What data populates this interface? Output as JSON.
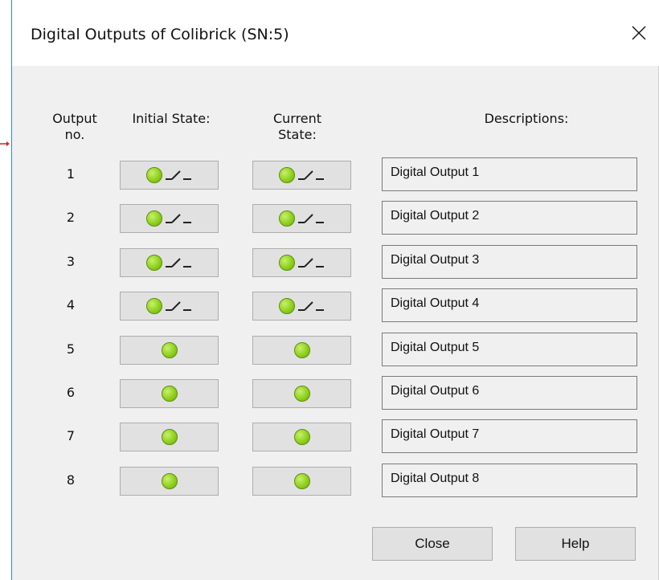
{
  "window": {
    "title": "Digital Outputs of Colibrick (SN:5)",
    "close_icon": "close-icon"
  },
  "headers": {
    "output_no_line1": "Output",
    "output_no_line2": "no.",
    "initial_state": "Initial State:",
    "current_state_line1": "Current",
    "current_state_line2": "State:",
    "descriptions": "Descriptions:"
  },
  "outputs": [
    {
      "number": "1",
      "initial_led": "on",
      "initial_switch": true,
      "current_led": "on",
      "current_switch": true,
      "description": "Digital Output 1"
    },
    {
      "number": "2",
      "initial_led": "on",
      "initial_switch": true,
      "current_led": "on",
      "current_switch": true,
      "description": "Digital Output 2"
    },
    {
      "number": "3",
      "initial_led": "on",
      "initial_switch": true,
      "current_led": "on",
      "current_switch": true,
      "description": "Digital Output 3"
    },
    {
      "number": "4",
      "initial_led": "on",
      "initial_switch": true,
      "current_led": "on",
      "current_switch": true,
      "description": "Digital Output 4"
    },
    {
      "number": "5",
      "initial_led": "on",
      "initial_switch": false,
      "current_led": "on",
      "current_switch": false,
      "description": "Digital Output 5"
    },
    {
      "number": "6",
      "initial_led": "on",
      "initial_switch": false,
      "current_led": "on",
      "current_switch": false,
      "description": "Digital Output 6"
    },
    {
      "number": "7",
      "initial_led": "on",
      "initial_switch": false,
      "current_led": "on",
      "current_switch": false,
      "description": "Digital Output 7"
    },
    {
      "number": "8",
      "initial_led": "on",
      "initial_switch": false,
      "current_led": "on",
      "current_switch": false,
      "description": "Digital Output 8"
    }
  ],
  "buttons": {
    "close_label": "Close",
    "help_label": "Help"
  },
  "colors": {
    "led_green": "#8fd01e",
    "button_face": "#e1e1e1",
    "dialog_bg": "#f0f0f0",
    "window_border": "#2b88d8",
    "arrow_red": "#c0282a"
  }
}
